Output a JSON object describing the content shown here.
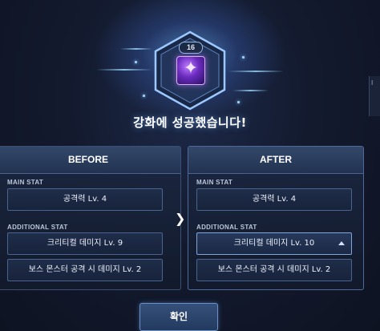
{
  "popup": {
    "level": "16",
    "title": "강화에 성공했습니다!",
    "item_icon": "purple-gem-item-icon",
    "confirm_label": "확인"
  },
  "before": {
    "header": "BEFORE",
    "main_stat_label": "MAIN STAT",
    "main_stat": "공격력 Lv. 4",
    "additional_stat_label": "ADDITIONAL STAT",
    "additional_stats": [
      "크리티컬 데미지 Lv. 9",
      "보스 몬스터 공격 시 데미지 Lv. 2"
    ]
  },
  "after": {
    "header": "AFTER",
    "main_stat_label": "MAIN STAT",
    "main_stat": "공격력 Lv. 4",
    "additional_stat_label": "ADDITIONAL STAT",
    "additional_stats": [
      "크리티컬 데미지 Lv. 10",
      "보스 몬스터 공격 시 데미지 Lv. 2"
    ]
  },
  "colors": {
    "accent": "#7fa6d9",
    "background": "#131a2e",
    "glow": "#6eb4ff"
  }
}
